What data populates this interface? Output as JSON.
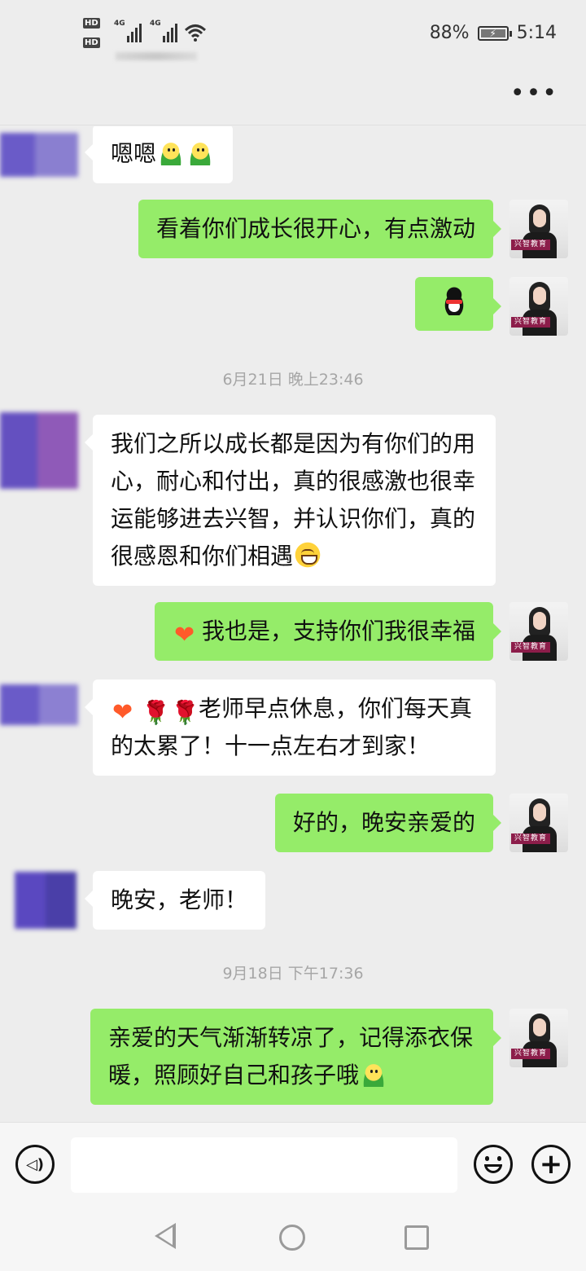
{
  "status_bar": {
    "hd1": "HD",
    "hd2": "HD",
    "net1": "4G",
    "net2": "4G",
    "battery": "88%",
    "time": "5:14"
  },
  "title_bar": {
    "more_label": "•••"
  },
  "timestamps": [
    "6月21日 晚上23:46",
    "9月18日 下午17:36"
  ],
  "messages": [
    {
      "side": "in",
      "text": "嗯嗯",
      "emoji": [
        "smile-emoji",
        "smile-emoji"
      ]
    },
    {
      "side": "out",
      "text": "看着你们成长很开心，有点激动"
    },
    {
      "side": "out",
      "text": "",
      "emoji": [
        "penguin-emoji"
      ]
    },
    {
      "side": "in",
      "text": "我们之所以成长都是因为有你们的用心，耐心和付出，真的很感激也很幸运能够进去兴智，并认识你们，真的很感恩和你们相遇",
      "emoji": [
        "grin-emoji"
      ]
    },
    {
      "side": "out",
      "text": "我也是，支持你们我很幸福",
      "emoji": [
        "heart-emoji"
      ]
    },
    {
      "side": "in",
      "text": "老师早点休息，你们每天真的太累了！十一点左右才到家！",
      "emoji": [
        "heart-emoji",
        "rose-emoji",
        "rose-emoji"
      ]
    },
    {
      "side": "out",
      "text": "好的，晚安亲爱的"
    },
    {
      "side": "in",
      "text": "晚安，老师！"
    },
    {
      "side": "out",
      "text": " 亲爱的天气渐渐转凉了，记得添衣保暖，照顾好自己和孩子哦",
      "emoji": [
        "smile-emoji"
      ]
    }
  ],
  "avatar_tag": "兴智教育",
  "input_bar": {
    "placeholder": ""
  },
  "colors": {
    "outgoing_bubble": "#95ec69",
    "incoming_bubble": "#ffffff",
    "background": "#ededed"
  }
}
